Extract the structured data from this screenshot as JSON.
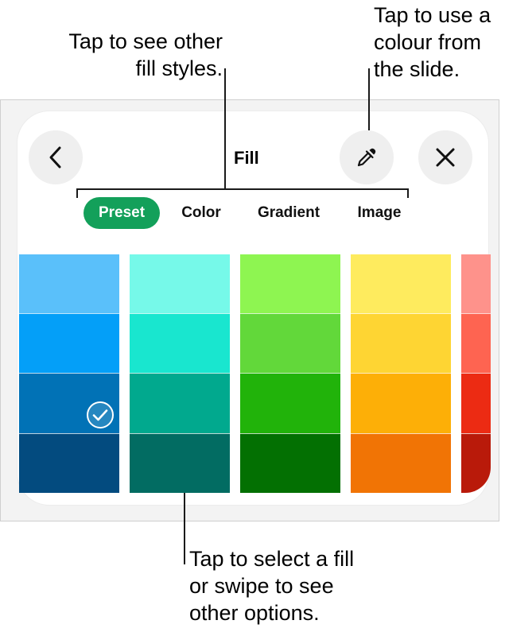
{
  "callouts": {
    "fill_styles": [
      "Tap to see other",
      "fill styles."
    ],
    "eyedropper": [
      "Tap to use a",
      "colour from",
      "the slide."
    ],
    "select_fill": [
      "Tap to select a fill",
      "or swipe to see",
      "other options."
    ]
  },
  "header": {
    "title": "Fill",
    "back_icon": "chevron-left-icon",
    "eyedropper_icon": "eyedropper-icon",
    "close_icon": "close-icon"
  },
  "tabs": [
    {
      "label": "Preset",
      "active": true
    },
    {
      "label": "Color",
      "active": false
    },
    {
      "label": "Gradient",
      "active": false
    },
    {
      "label": "Image",
      "active": false
    }
  ],
  "active_color": "#13a05a",
  "swatches": [
    {
      "name": "blue",
      "colors": [
        "#5ac0fa",
        "#049ff8",
        "#0172b6",
        "#034b7f"
      ],
      "selected_index": 2
    },
    {
      "name": "teal",
      "colors": [
        "#76f9e9",
        "#19e6cf",
        "#01a98e",
        "#026c62"
      ],
      "selected_index": null
    },
    {
      "name": "green",
      "colors": [
        "#8ef551",
        "#62d83a",
        "#21b30a",
        "#037002"
      ],
      "selected_index": null
    },
    {
      "name": "yellow",
      "colors": [
        "#feeb5e",
        "#fed533",
        "#fdaf07",
        "#f17405"
      ],
      "selected_index": null
    },
    {
      "name": "red",
      "colors": [
        "#fe928b",
        "#fe6451",
        "#ec2b13",
        "#b91a0a"
      ],
      "selected_index": null
    }
  ]
}
